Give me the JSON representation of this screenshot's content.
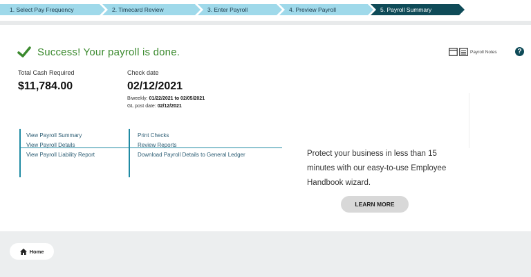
{
  "stepper": {
    "steps": [
      {
        "label": "1.  Select Pay Frequency",
        "state": "complete"
      },
      {
        "label": "2.  Timecard Review",
        "state": "complete"
      },
      {
        "label": "3.  Enter Payroll",
        "state": "complete"
      },
      {
        "label": "4.  Preview Payroll",
        "state": "complete"
      },
      {
        "label": "5.  Payroll Summary",
        "state": "active"
      }
    ]
  },
  "success": {
    "icon": "check-icon",
    "message": "Success! Your payroll is done."
  },
  "toolbar": {
    "notes_label": "Payroll Notes",
    "help_symbol": "?"
  },
  "summary": {
    "cash_label": "Total Cash Required",
    "cash_value": "$11,784.00",
    "check_date_label": "Check date",
    "check_date_value": "02/12/2021",
    "period_prefix": "Biweekly:",
    "period_value": "01/22/2021 to 02/05/2021",
    "gl_prefix": "GL post date:",
    "gl_value": "02/12/2021"
  },
  "links": {
    "left": [
      "View Payroll Summary",
      "View Payroll Details",
      "View Payroll Liability Report"
    ],
    "right": [
      "Print Checks",
      "Review Reports",
      "Download Payroll Details to General Ledger"
    ]
  },
  "promo": {
    "text": "Protect your business in less than 15 minutes with our easy-to-use Employee Handbook wizard.",
    "button": "LEARN MORE"
  },
  "footer": {
    "home_label": "Home"
  },
  "colors": {
    "step_todo": "#9fd9ea",
    "step_active": "#0f4b58",
    "success_green": "#3b8a2e",
    "link_blue": "#2b5c73",
    "divider_teal": "#1f8aa3"
  }
}
